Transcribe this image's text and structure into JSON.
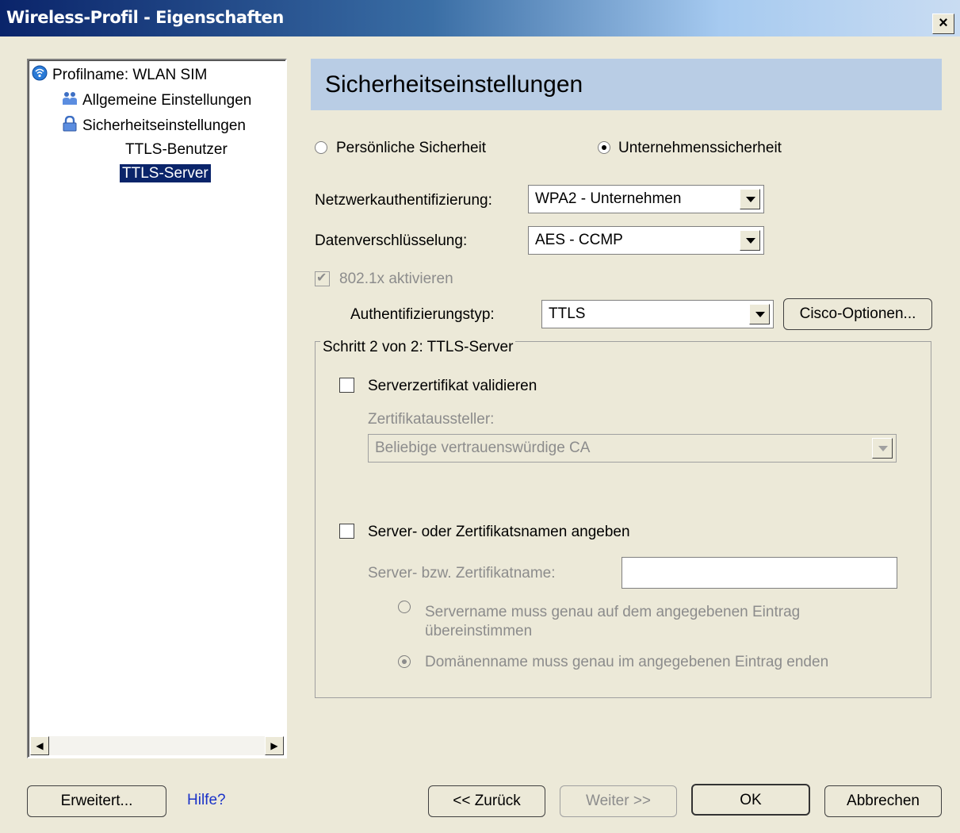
{
  "window": {
    "title": "Wireless-Profil - Eigenschaften",
    "close": "×"
  },
  "tree": {
    "profile": "Profilname: WLAN SIM",
    "items": [
      "Allgemeine Einstellungen",
      "Sicherheitseinstellungen"
    ],
    "subitems": [
      "TTLS-Benutzer",
      "TTLS-Server"
    ],
    "selected": "TTLS-Server"
  },
  "header": {
    "title": "Sicherheitseinstellungen"
  },
  "security": {
    "personal_label": "Persönliche Sicherheit",
    "enterprise_label": "Unternehmenssicherheit",
    "selected": "enterprise"
  },
  "netauth": {
    "label": "Netzwerkauthentifizierung:",
    "value": "WPA2 - Unternehmen"
  },
  "encryption": {
    "label": "Datenverschlüsselung:",
    "value": "AES - CCMP"
  },
  "dot1x": {
    "label": "802.1x aktivieren",
    "checked": true
  },
  "authtype": {
    "label": "Authentifizierungstyp:",
    "value": "TTLS",
    "cisco_button": "Cisco-Optionen..."
  },
  "group": {
    "label": "Schritt 2 von 2: TTLS-Server",
    "validate_label": "Serverzertifikat validieren",
    "issuer_label": "Zertifikataussteller:",
    "issuer_value": "Beliebige vertrauenswürdige CA",
    "specify_label": "Server- oder Zertifikatsnamen angeben",
    "name_label": "Server- bzw. Zertifikatname:",
    "name_value": "",
    "radio1_line1": "Servername muss genau auf dem angegebenen Eintrag",
    "radio1_line2": "übereinstimmen",
    "radio2_label": "Domänenname muss genau im angegebenen Eintrag enden"
  },
  "footer": {
    "advanced": "Erweitert...",
    "help": "Hilfe?",
    "back": "<< Zurück",
    "next": "Weiter >>",
    "ok": "OK",
    "cancel": "Abbrechen"
  }
}
